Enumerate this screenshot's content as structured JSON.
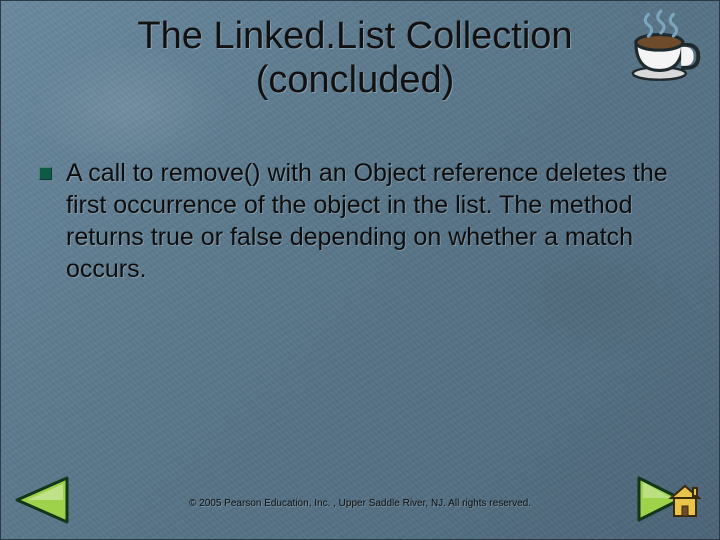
{
  "title_line1": "The Linked.List Collection",
  "title_line2": "(concluded)",
  "bullet1": "A call to remove() with an Object reference deletes the first occurrence of the object in the list.  The method returns true or false depending on whether a match occurs.",
  "copyright": "© 2005 Pearson Education, Inc. , Upper Saddle River, NJ.  All rights reserved.",
  "colors": {
    "bullet_square": "#0e5a47",
    "arrow_fill": "#9fd24b",
    "arrow_stroke": "#12361a",
    "house_fill": "#e9c44a",
    "house_stroke": "#3a2a08"
  }
}
